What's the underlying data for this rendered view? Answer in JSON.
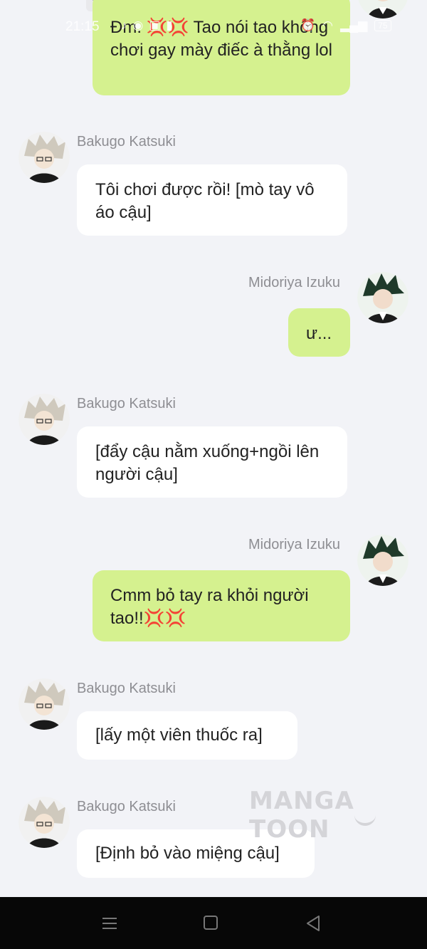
{
  "status_bar": {
    "time": "21:15",
    "battery": "75"
  },
  "top_partial": {
    "counter": "1",
    "text": "Đm. 💢💢 Tao nói tao không chơi gay mày điếc à thằng lol"
  },
  "messages": [
    {
      "sender": "Bakugo Katsuki",
      "side": "left",
      "text": "Tôi chơi được rồi! [mò tay vô áo cậu]"
    },
    {
      "sender": "Midoriya Izuku",
      "side": "right",
      "text": "ư..."
    },
    {
      "sender": "Bakugo Katsuki",
      "side": "left",
      "text": "[đẩy cậu nằm xuống+ngồi lên người cậu]"
    },
    {
      "sender": "Midoriya Izuku",
      "side": "right",
      "text": "Cmm bỏ tay ra khỏi người tao!!💢💢"
    },
    {
      "sender": "Bakugo Katsuki",
      "side": "left",
      "text": "[lấy một viên thuốc ra]"
    },
    {
      "sender": "Bakugo Katsuki",
      "side": "left",
      "text": "[Định bỏ vào miệng cậu]"
    }
  ],
  "watermark": "MANGA TOON",
  "colors": {
    "background": "#f2f3f7",
    "incoming_bubble": "#ffffff",
    "outgoing_bubble": "#d5f18f",
    "name_text": "#8e8e93"
  },
  "icons": {
    "nav": [
      "menu-icon",
      "home-square-icon",
      "back-triangle-icon"
    ]
  }
}
